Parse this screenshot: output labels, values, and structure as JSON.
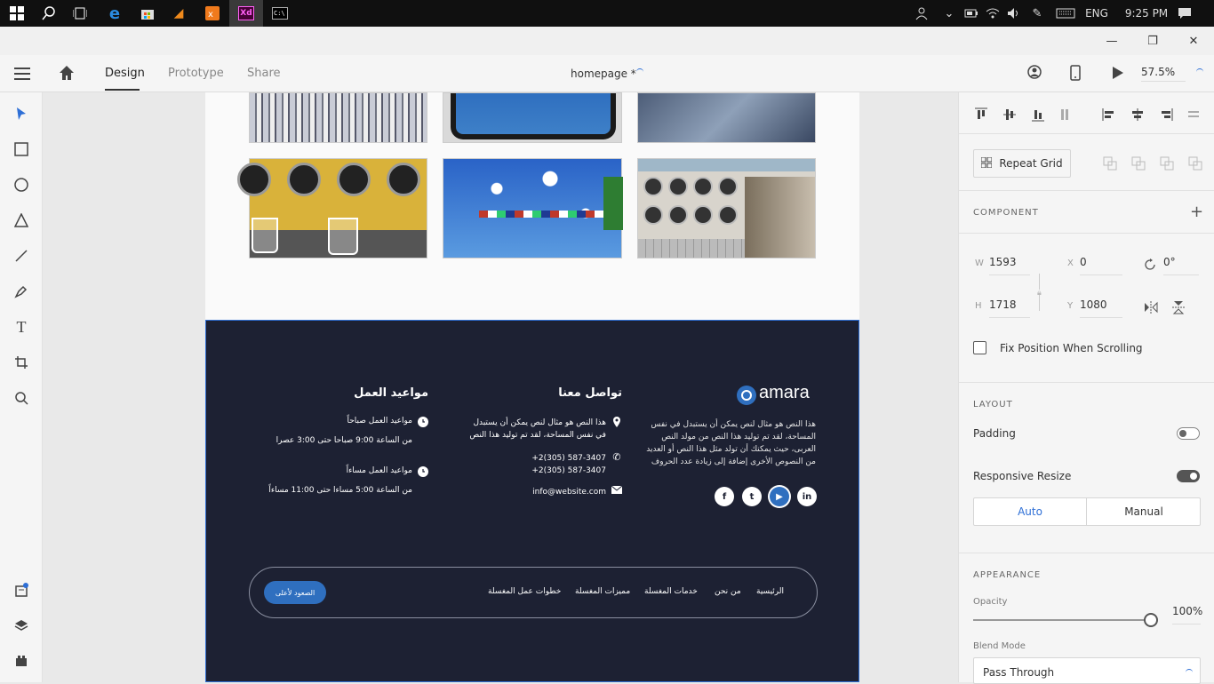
{
  "taskbar": {
    "icons": [
      "windows-start-icon",
      "search-icon",
      "task-view-icon",
      "edge-icon",
      "store-icon",
      "vlc-icon",
      "xampp-icon",
      "adobe-xd-icon",
      "cmd-icon"
    ],
    "xd_label": "Xd",
    "cmd_label": "C:\\",
    "lang": "ENG",
    "time": "9:25 PM"
  },
  "appbar": {
    "tabs": [
      "Design",
      "Prototype",
      "Share"
    ],
    "active_tab": "Design",
    "doc_title": "homepage *",
    "zoom": "57.5%"
  },
  "footer": {
    "logo_text": "amara",
    "about_text": "هذا النص هو مثال لنص يمكن أن يستبدل في نفس المساحة، لقد تم توليد هذا النص من مولد النص العربى، حيث يمكنك أن تولد مثل هذا النص أو العديد من النصوص الأخرى إضافة إلى زيادة عدد الحروف",
    "contact_title": "تواصل معنا",
    "contact_address": "هذا النص هو مثال لنص يمكن أن يستبدل في نفس المساحة، لقد تم توليد هذا النص",
    "phone_1": "+2(305) 587-3407",
    "phone_2": "+2(305) 587-3407",
    "email": "info@website.com",
    "hours_title": "مواعيد العمل",
    "morning_label": "مواعيد العمل صباحاً",
    "morning_hours": "من الساعة 9:00 صباحا حتى 3:00 عصرا",
    "evening_label": "مواعيد العمل مساءاً",
    "evening_hours": "من الساعة 5:00 مساءا حتى 11:00 مساءاً",
    "socials": [
      "f",
      "t",
      "▶",
      "in"
    ],
    "nav": [
      "الرئيسية",
      "من نحن",
      "خدمات المغسلة",
      "مميزات المغسلة",
      "خطوات عمل المغسلة"
    ],
    "back_to_top": "الصعود لأعلى"
  },
  "panel": {
    "repeat_grid": "Repeat Grid",
    "component_label": "COMPONENT",
    "w_label": "W",
    "w_value": "1593",
    "x_label": "X",
    "x_value": "0",
    "rotation_value": "0°",
    "h_label": "H",
    "h_value": "1718",
    "y_label": "Y",
    "y_value": "1080",
    "fix_position": "Fix Position When Scrolling",
    "layout_label": "LAYOUT",
    "padding": "Padding",
    "responsive_resize": "Responsive Resize",
    "auto": "Auto",
    "manual": "Manual",
    "appearance_label": "APPEARANCE",
    "opacity_label": "Opacity",
    "opacity_value": "100%",
    "opacity_fraction": 1.0,
    "blend_label": "Blend Mode",
    "blend_value": "Pass Through"
  },
  "colors": {
    "footer_bg": "#1d2133",
    "accent": "#2f6fbf",
    "selection": "#2e6fd6"
  }
}
